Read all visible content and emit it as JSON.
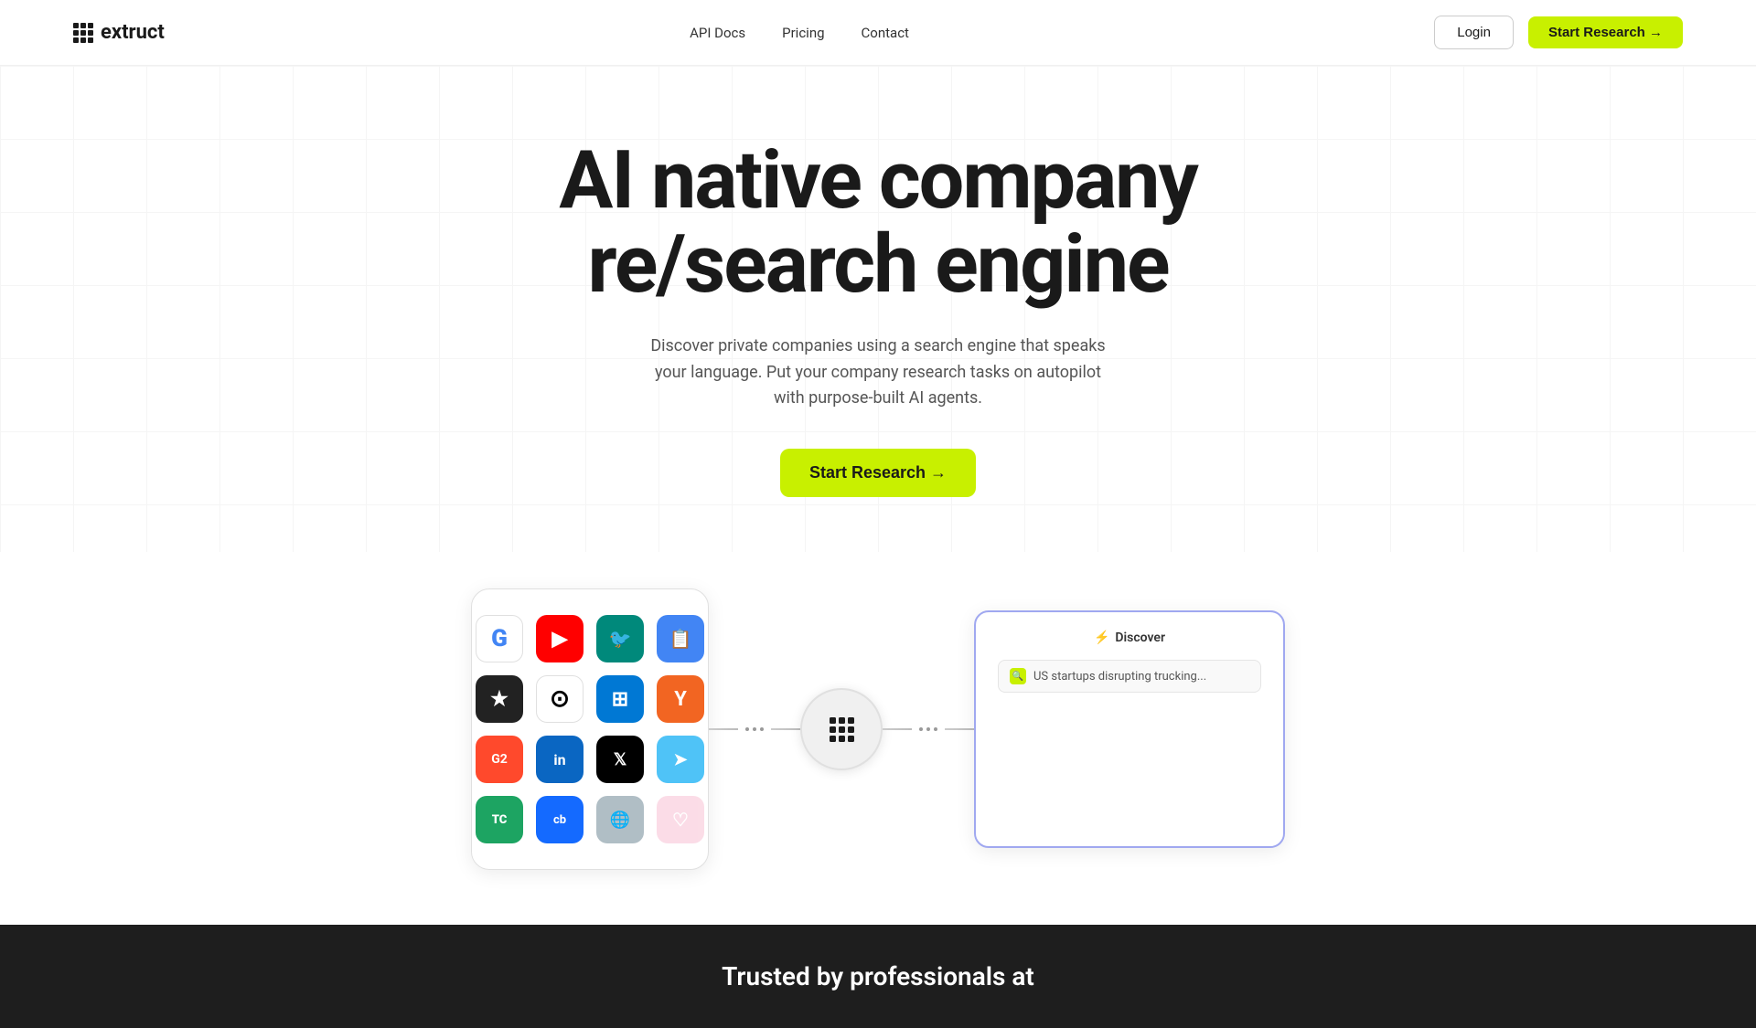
{
  "nav": {
    "logo_text": "extruct",
    "links": [
      {
        "label": "API Docs",
        "id": "api-docs"
      },
      {
        "label": "Pricing",
        "id": "pricing"
      },
      {
        "label": "Contact",
        "id": "contact"
      }
    ],
    "login_label": "Login",
    "start_research_label": "Start Research →"
  },
  "hero": {
    "title_line1": "AI native company",
    "title_line2": "re/search engine",
    "subtitle": "Discover private companies using a search engine that speaks your language. Put your company research tasks on autopilot with purpose-built AI agents.",
    "cta_label": "Start Research →"
  },
  "diagram": {
    "center_label": "extruct-center",
    "discover_header": "Discover",
    "discover_lightning": "⚡",
    "search_query": "US startups disrupting trucking..."
  },
  "icons": [
    {
      "id": "google",
      "label": "G",
      "class": "icon-google"
    },
    {
      "id": "youtube",
      "label": "▶",
      "class": "icon-youtube"
    },
    {
      "id": "teal",
      "label": "🐦",
      "class": "icon-teal"
    },
    {
      "id": "docs",
      "label": "📄",
      "class": "icon-docs"
    },
    {
      "id": "star",
      "label": "★",
      "class": "icon-star"
    },
    {
      "id": "github",
      "label": "⊙",
      "class": "icon-github"
    },
    {
      "id": "sharepoint",
      "label": "⊞",
      "class": "icon-sharepoint"
    },
    {
      "id": "yc",
      "label": "Y",
      "class": "icon-ycombinator"
    },
    {
      "id": "g2",
      "label": "G2",
      "class": "icon-g2"
    },
    {
      "id": "linkedin",
      "label": "in",
      "class": "icon-linkedin"
    },
    {
      "id": "x",
      "label": "𝕏",
      "class": "icon-x"
    },
    {
      "id": "arrow",
      "label": "➤",
      "class": "icon-arrow"
    },
    {
      "id": "tc",
      "label": "TC",
      "class": "icon-tc"
    },
    {
      "id": "cb",
      "label": "cb",
      "class": "icon-cb"
    },
    {
      "id": "web",
      "label": "🌐",
      "class": "icon-web"
    },
    {
      "id": "pink",
      "label": "♡",
      "class": "icon-pink"
    }
  ],
  "bottom": {
    "title": "Trusted by professionals at"
  },
  "colors": {
    "accent": "#c8f000",
    "dark_bg": "#1e1e1e"
  }
}
